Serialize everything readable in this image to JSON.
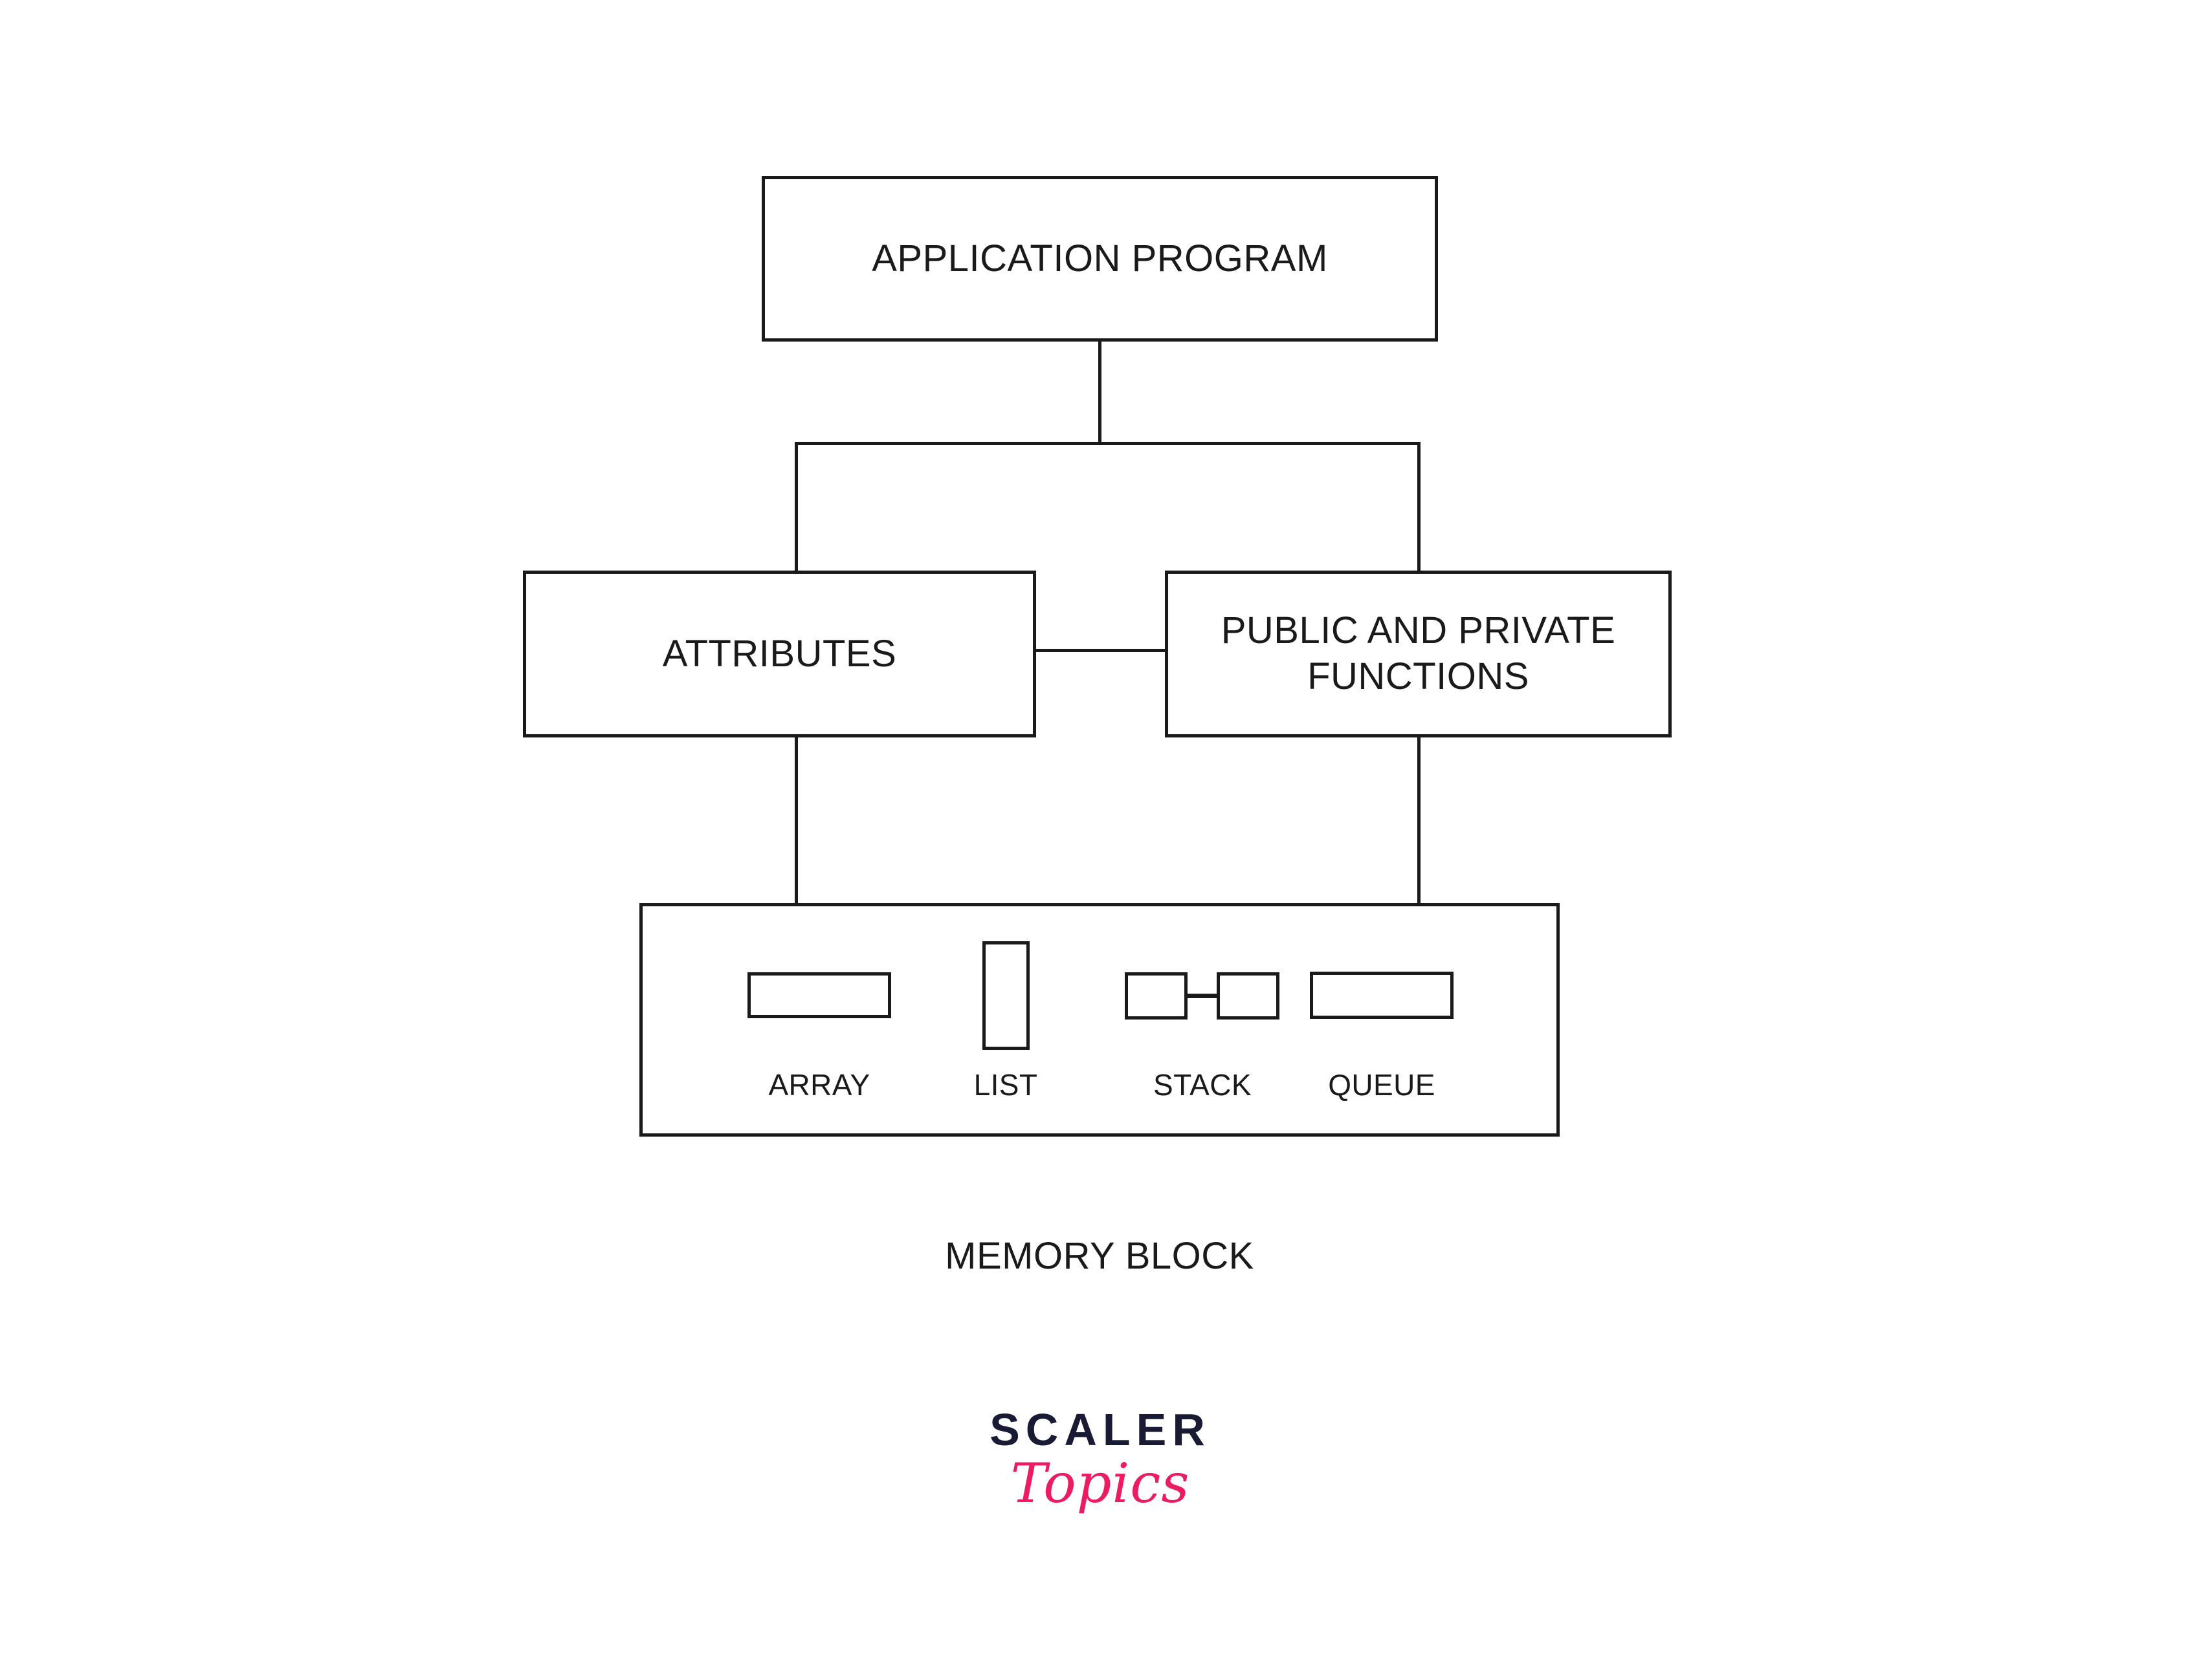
{
  "diagram": {
    "title_text": "",
    "nodes": {
      "application_program": "APPLICATION PROGRAM",
      "attributes": "ATTRIBUTES",
      "public_private_functions_line1": "PUBLIC AND PRIVATE",
      "public_private_functions_line2": "FUNCTIONS",
      "memory_block_caption": "MEMORY BLOCK"
    },
    "data_structures": [
      {
        "name": "ARRAY",
        "shape": "horizontal-rectangle"
      },
      {
        "name": "LIST",
        "shape": "vertical-rectangle"
      },
      {
        "name": "STACK",
        "shape": "two-boxes-with-arrow"
      },
      {
        "name": "QUEUE",
        "shape": "horizontal-rectangle"
      }
    ],
    "colors": {
      "stroke": "#1a1a1a",
      "background": "#ffffff",
      "logo_dark": "#191A33",
      "logo_pink": "#EC1C62"
    }
  },
  "logo": {
    "brand": "SCALER",
    "sub_brand": "Topics"
  }
}
